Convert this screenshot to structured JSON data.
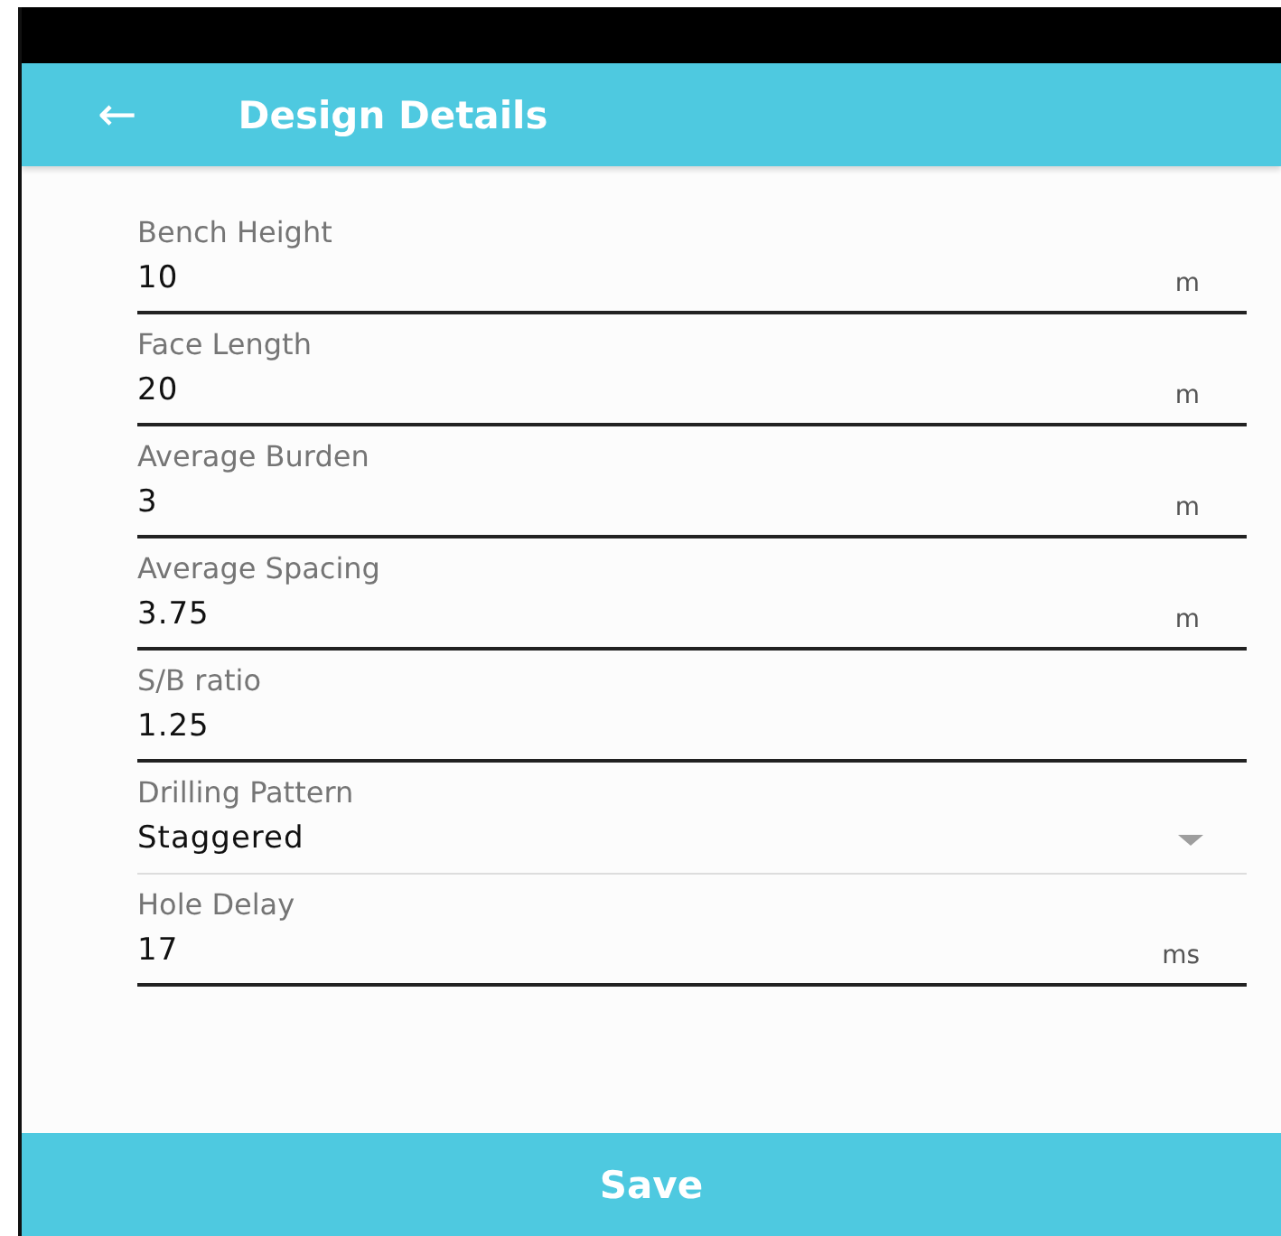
{
  "app_bar": {
    "back_icon": "←",
    "title": "Design Details"
  },
  "fields": [
    {
      "kind": "input",
      "label": "Bench Height",
      "value": "10",
      "unit": "m"
    },
    {
      "kind": "input",
      "label": "Face Length",
      "value": "20",
      "unit": "m"
    },
    {
      "kind": "input",
      "label": "Average Burden",
      "value": "3",
      "unit": "m"
    },
    {
      "kind": "input",
      "label": "Average Spacing",
      "value": "3.75",
      "unit": "m"
    },
    {
      "kind": "input",
      "label": "S/B ratio",
      "value": "1.25"
    },
    {
      "kind": "dropdown",
      "label": "Drilling Pattern",
      "value": "Staggered"
    },
    {
      "kind": "input",
      "label": "Hole Delay",
      "value": "17",
      "unit": "ms"
    }
  ],
  "save_button": "Save"
}
